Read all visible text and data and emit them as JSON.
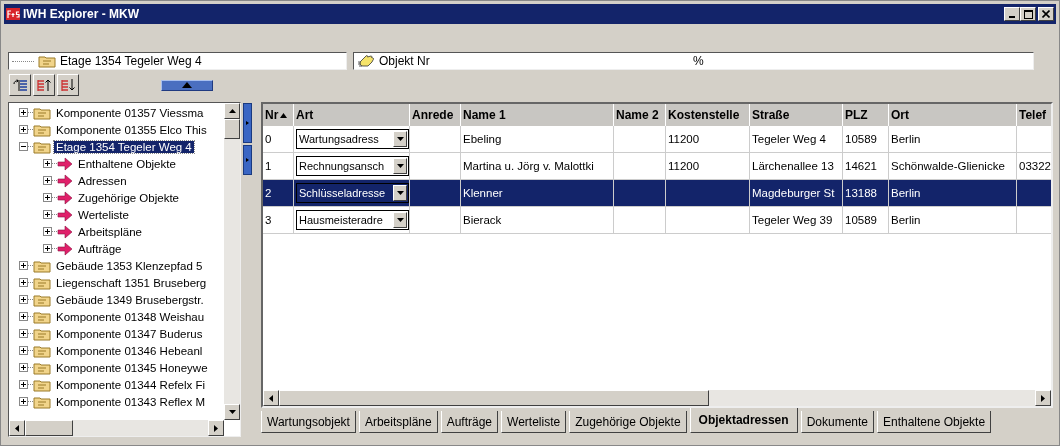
{
  "window": {
    "title": "IWH Explorer - MKW"
  },
  "location_field": {
    "text": "Etage 1354 Tegeler Weg 4"
  },
  "filter": {
    "label": "Objekt Nr",
    "value": "%"
  },
  "tree": {
    "items": [
      {
        "label": "Komponente 01357 Viessma",
        "kind": "folder",
        "expanded": false,
        "selected": false
      },
      {
        "label": "Komponente 01355 Elco This",
        "kind": "folder",
        "expanded": false,
        "selected": false
      },
      {
        "label": "Etage 1354 Tegeler Weg 4",
        "kind": "folder",
        "expanded": true,
        "selected": true,
        "children": [
          {
            "label": "Enthaltene Objekte",
            "kind": "link",
            "expanded": false,
            "selected": false
          },
          {
            "label": "Adressen",
            "kind": "link",
            "expanded": false,
            "selected": false
          },
          {
            "label": "Zugehörige Objekte",
            "kind": "link",
            "expanded": false,
            "selected": false
          },
          {
            "label": "Werteliste",
            "kind": "link",
            "expanded": false,
            "selected": false
          },
          {
            "label": "Arbeitspläne",
            "kind": "link",
            "expanded": false,
            "selected": false
          },
          {
            "label": "Aufträge",
            "kind": "link",
            "expanded": false,
            "selected": false
          }
        ]
      },
      {
        "label": "Gebäude 1353 Klenzepfad 5",
        "kind": "folder",
        "expanded": false,
        "selected": false
      },
      {
        "label": "Liegenschaft 1351 Bruseberg",
        "kind": "folder",
        "expanded": false,
        "selected": false
      },
      {
        "label": "Gebäude 1349 Brusebergstr.",
        "kind": "folder",
        "expanded": false,
        "selected": false
      },
      {
        "label": "Komponente 01348 Weishau",
        "kind": "folder",
        "expanded": false,
        "selected": false
      },
      {
        "label": "Komponente 01347 Buderus",
        "kind": "folder",
        "expanded": false,
        "selected": false
      },
      {
        "label": "Komponente 01346 Hebeanl",
        "kind": "folder",
        "expanded": false,
        "selected": false
      },
      {
        "label": "Komponente 01345 Honeywe",
        "kind": "folder",
        "expanded": false,
        "selected": false
      },
      {
        "label": "Komponente 01344 Refelx Fi",
        "kind": "folder",
        "expanded": false,
        "selected": false
      },
      {
        "label": "Komponente 01343 Reflex M",
        "kind": "folder",
        "expanded": false,
        "selected": false
      }
    ]
  },
  "table": {
    "columns": [
      {
        "label": "Nr",
        "sorted": true
      },
      {
        "label": "Art",
        "sorted": false
      },
      {
        "label": "Anrede",
        "sorted": false
      },
      {
        "label": "Name 1",
        "sorted": false
      },
      {
        "label": "Name 2",
        "sorted": false
      },
      {
        "label": "Kostenstelle",
        "sorted": false
      },
      {
        "label": "Straße",
        "sorted": false
      },
      {
        "label": "PLZ",
        "sorted": false
      },
      {
        "label": "Ort",
        "sorted": false
      },
      {
        "label": "Telef",
        "sorted": false
      }
    ],
    "rows": [
      {
        "selected": false,
        "nr": "0",
        "art": "Wartungsadress",
        "anrede": "",
        "name1": "Ebeling",
        "name2": "",
        "kostenstelle": "11200",
        "strasse": "Tegeler Weg 4",
        "plz": "10589",
        "ort": "Berlin",
        "telefon": ""
      },
      {
        "selected": false,
        "nr": "1",
        "art": "Rechnungsansch",
        "anrede": "",
        "name1": "Martina u. Jörg v. Malottki",
        "name2": "",
        "kostenstelle": "11200",
        "strasse": "Lärchenallee 13",
        "plz": "14621",
        "ort": "Schönwalde-Glienicke",
        "telefon": "03322"
      },
      {
        "selected": true,
        "nr": "2",
        "art": "Schlüsseladresse",
        "anrede": "",
        "name1": "Klenner",
        "name2": "",
        "kostenstelle": "",
        "strasse": "Magdeburger St",
        "plz": "13188",
        "ort": "Berlin",
        "telefon": ""
      },
      {
        "selected": false,
        "nr": "3",
        "art": "Hausmeisteradre",
        "anrede": "",
        "name1": "Bierack",
        "name2": "",
        "kostenstelle": "",
        "strasse": "Tegeler Weg 39",
        "plz": "10589",
        "ort": "Berlin",
        "telefon": ""
      }
    ]
  },
  "tabs": [
    {
      "label": "Wartungsobjekt",
      "selected": false
    },
    {
      "label": "Arbeitspläne",
      "selected": false
    },
    {
      "label": "Aufträge",
      "selected": false
    },
    {
      "label": "Werteliste",
      "selected": false
    },
    {
      "label": "Zugehörige Objekte",
      "selected": false
    },
    {
      "label": "Objektadressen",
      "selected": true
    },
    {
      "label": "Dokumente",
      "selected": false
    },
    {
      "label": "Enthaltene Objekte",
      "selected": false
    }
  ]
}
